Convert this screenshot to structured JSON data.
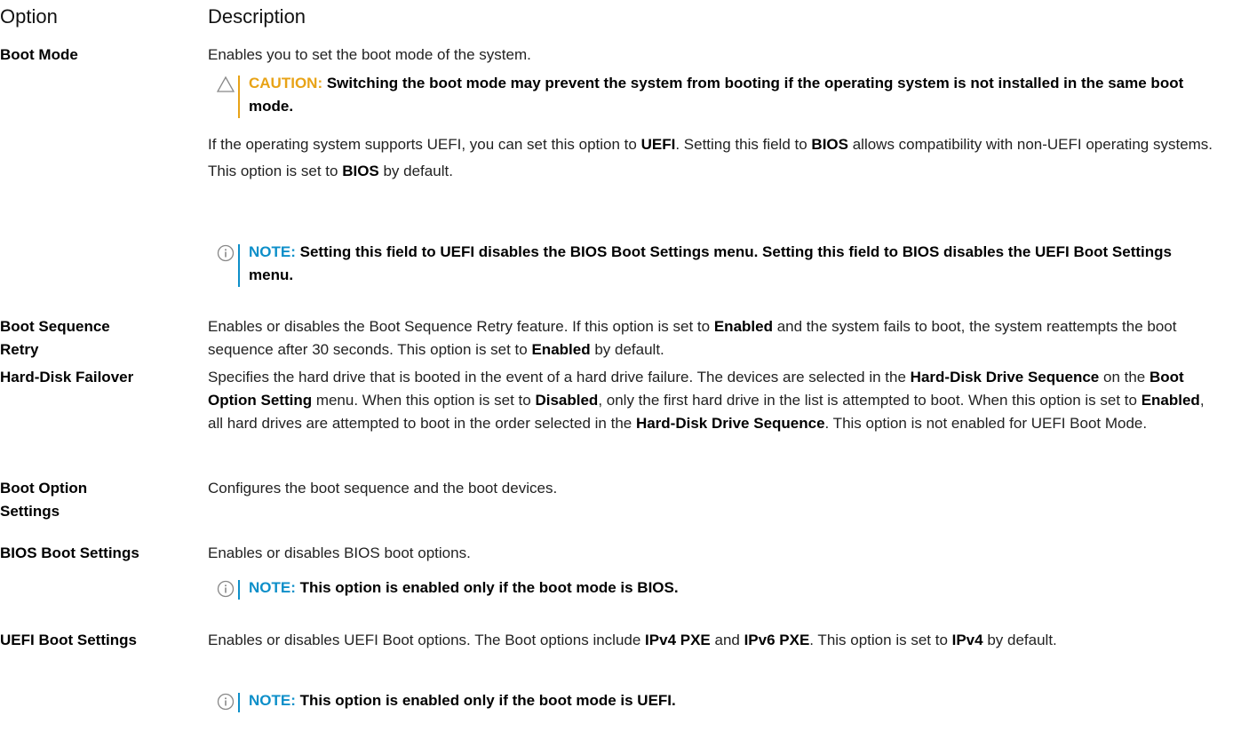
{
  "colors": {
    "caution": "#e8a317",
    "note": "#0d8fc9"
  },
  "header": {
    "option": "Option",
    "description": "Description"
  },
  "rows": {
    "boot_mode": {
      "option": "Boot Mode",
      "p1": "Enables you to set the boot mode of the system.",
      "caution_label": "CAUTION:",
      "caution_text": "Switching the boot mode may prevent the system from booting if the operating system is not installed in the same boot mode.",
      "p2": [
        "If the operating system supports UEFI, you can set this option to ",
        "UEFI",
        ". Setting this field to ",
        "BIOS",
        " allows compatibility with non-UEFI operating systems. This option is set to ",
        "BIOS",
        " by default."
      ],
      "note_label": "NOTE:",
      "note_text": "Setting this field to UEFI disables the BIOS Boot Settings menu. Setting this field to BIOS disables the UEFI Boot Settings menu."
    },
    "boot_sequence_retry": {
      "option_line1": "Boot Sequence",
      "option_line2": "Retry",
      "text": [
        "Enables or disables the Boot Sequence Retry feature. If this option is set to ",
        "Enabled",
        " and the system fails to boot, the system reattempts the boot sequence after 30 seconds. This option is set to ",
        "Enabled",
        " by default."
      ]
    },
    "hard_disk_failover": {
      "option": "Hard-Disk Failover",
      "text": [
        "Specifies the hard drive that is booted in the event of a hard drive failure. The devices are selected in the ",
        "Hard-Disk Drive Sequence",
        " on the ",
        "Boot Option Setting",
        " menu. When this option is set to ",
        "Disabled",
        ", only the first hard drive in the list is attempted to boot. When this option is set to ",
        "Enabled",
        ", all hard drives are attempted to boot in the order selected in the ",
        "Hard-Disk Drive Sequence",
        ". This option is not enabled for UEFI Boot Mode."
      ]
    },
    "boot_option_settings": {
      "option_line1": "Boot Option",
      "option_line2": "Settings",
      "text": "Configures the boot sequence and the boot devices."
    },
    "bios_boot_settings": {
      "option": "BIOS Boot Settings",
      "text": "Enables or disables BIOS boot options.",
      "note_label": "NOTE:",
      "note_text": "This option is enabled only if the boot mode is BIOS."
    },
    "uefi_boot_settings": {
      "option": "UEFI Boot Settings",
      "text": [
        "Enables or disables UEFI Boot options. The Boot options include ",
        "IPv4 PXE",
        " and ",
        "IPv6 PXE",
        ". This option is set to ",
        "IPv4",
        " by default."
      ],
      "note_label": "NOTE:",
      "note_text": "This option is enabled only if the boot mode is UEFI."
    }
  }
}
